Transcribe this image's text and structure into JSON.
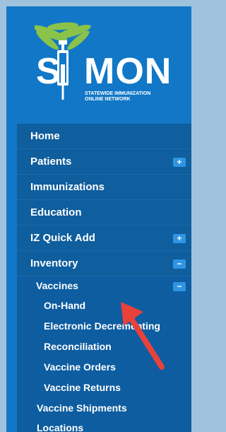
{
  "logo": {
    "letter_s": "S",
    "letters_mon": "MON",
    "tagline_line1": "STATEWIDE IMMUNIZATION",
    "tagline_line2": "ONLINE NETWORK"
  },
  "menu": {
    "items": [
      {
        "label": "Home"
      },
      {
        "label": "Patients",
        "toggle": "+"
      },
      {
        "label": "Immunizations"
      },
      {
        "label": "Education"
      },
      {
        "label": "IZ Quick Add",
        "toggle": "+"
      },
      {
        "label": "Inventory",
        "toggle": "−"
      }
    ],
    "vaccines": {
      "label": "Vaccines",
      "toggle": "−"
    },
    "vaccine_subitems": [
      {
        "label": "On-Hand"
      },
      {
        "label": "Electronic Decrementing"
      },
      {
        "label": "Reconciliation"
      },
      {
        "label": "Vaccine Orders"
      },
      {
        "label": "Vaccine Returns"
      }
    ],
    "after_items": [
      {
        "label": "Vaccine Shipments"
      },
      {
        "label": "Locations"
      }
    ]
  },
  "colors": {
    "sidebar_bg": "#1177c6",
    "menu_item_bg": "#0f5e9d",
    "toggle_bg": "#2f95e3",
    "arrow": "#e8413a",
    "palm": "#8bc34a"
  }
}
